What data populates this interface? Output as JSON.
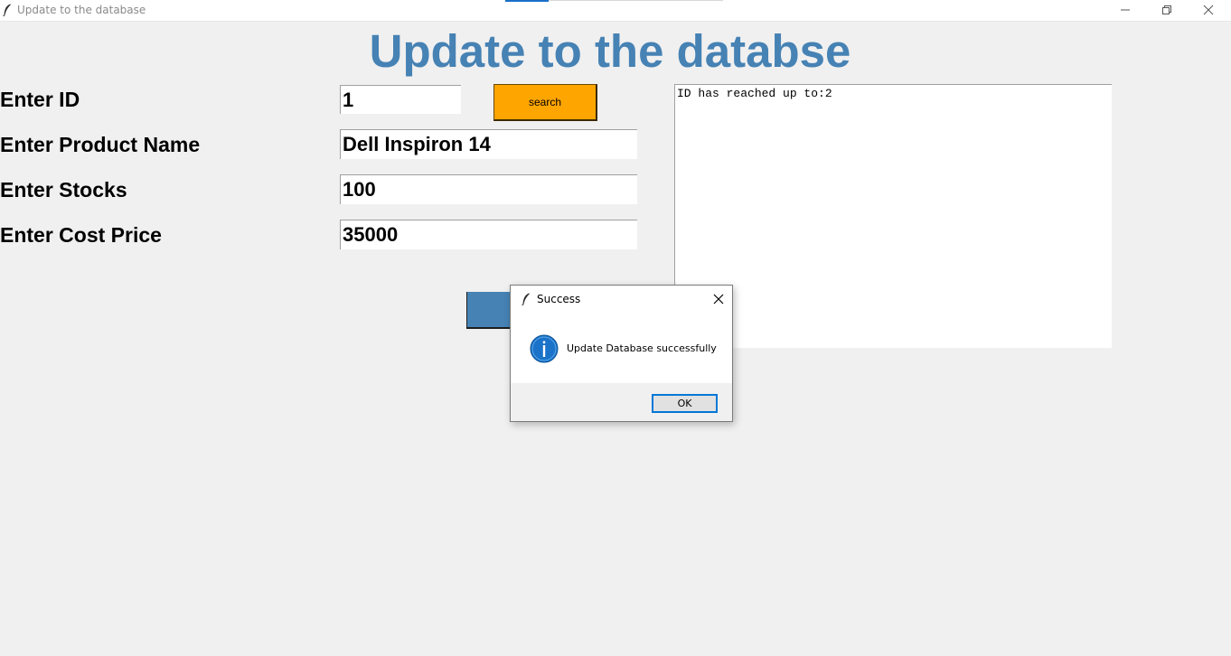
{
  "window": {
    "title": "Update to the database",
    "icon": "feather-icon"
  },
  "form": {
    "heading": "Update to the databse",
    "fields": [
      {
        "label": "Enter ID",
        "value": "1"
      },
      {
        "label": "Enter Product Name",
        "value": "Dell Inspiron 14"
      },
      {
        "label": "Enter Stocks",
        "value": "100"
      },
      {
        "label": "Enter Cost Price",
        "value": "35000"
      }
    ],
    "search_label": "search",
    "log_text": "ID has reached up to:2"
  },
  "dialog": {
    "title": "Success",
    "message": "Update Database successfully",
    "ok_label": "OK",
    "icon": "info-icon"
  },
  "colors": {
    "heading": "#4682b4",
    "search_button": "#ffa500",
    "update_button": "#4682b4",
    "background": "#f0f0f0"
  }
}
